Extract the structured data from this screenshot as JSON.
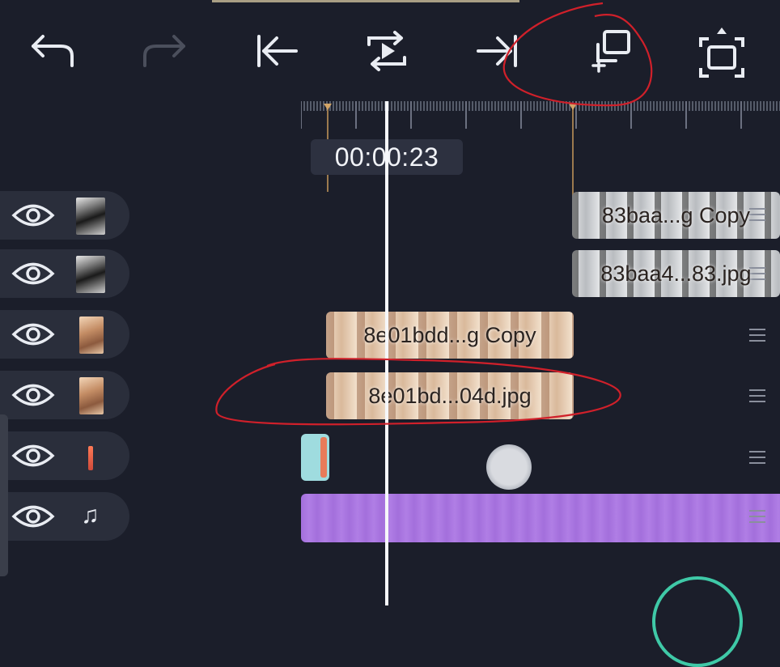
{
  "toolbar": {
    "undo": "undo-icon",
    "redo": "redo-icon",
    "jump_start": "jump-to-start-icon",
    "loop_play": "loop-play-icon",
    "jump_end": "jump-to-end-icon",
    "duplicate": "duplicate-icon",
    "fullscreen": "fullscreen-icon"
  },
  "timecode": "00:00:23",
  "tracks": [
    {
      "type": "image",
      "thumb": "bw",
      "clip_label": "83baa...g Copy"
    },
    {
      "type": "image",
      "thumb": "bw",
      "clip_label": "83baa4...83.jpg"
    },
    {
      "type": "image",
      "thumb": "warm",
      "clip_label": "8e01bdd...g Copy"
    },
    {
      "type": "image",
      "thumb": "warm",
      "clip_label": "8e01bd...04d.jpg"
    },
    {
      "type": "overlay",
      "thumb": "bar"
    },
    {
      "type": "audio",
      "thumb": "music-icon"
    }
  ],
  "colors": {
    "background": "#1b1e2a",
    "track_header": "#2a2e3b",
    "audio_clip": "#a36fdc",
    "annotation": "#d0202a",
    "accent": "#3fc9a7"
  }
}
